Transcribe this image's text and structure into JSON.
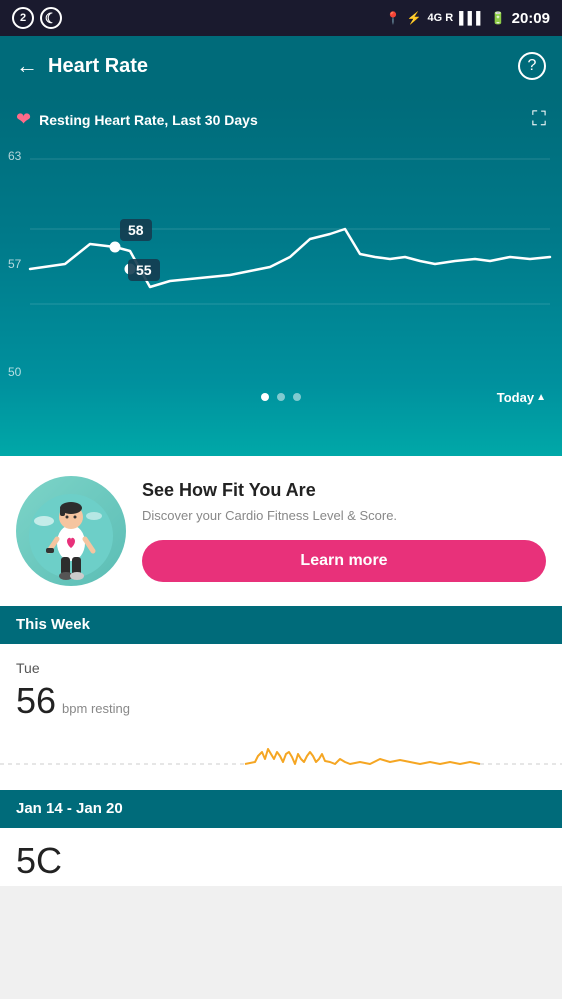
{
  "statusBar": {
    "leftIcons": [
      "2",
      "phone"
    ],
    "rightIcons": [
      "location",
      "bluetooth",
      "4G",
      "signal",
      "battery"
    ],
    "time": "20:09"
  },
  "header": {
    "backLabel": "←",
    "title": "Heart Rate",
    "helpLabel": "?"
  },
  "chart": {
    "subtitle": "Resting Heart Rate, Last 30 Days",
    "yLabels": [
      "63",
      "57",
      "50"
    ],
    "tooltipHigh": "58",
    "tooltipLow": "55",
    "dots": [
      true,
      false,
      false
    ],
    "todayLabel": "Today"
  },
  "cardio": {
    "title": "See How Fit You Are",
    "description": "Discover your Cardio Fitness Level & Score.",
    "learnMoreLabel": "Learn more"
  },
  "thisWeek": {
    "sectionLabel": "This Week",
    "dayLabel": "Tue",
    "bpmValue": "56",
    "bpmUnit": "bpm resting"
  },
  "janSection": {
    "sectionLabel": "Jan 14 - Jan 20",
    "bpmValue": "5C"
  }
}
